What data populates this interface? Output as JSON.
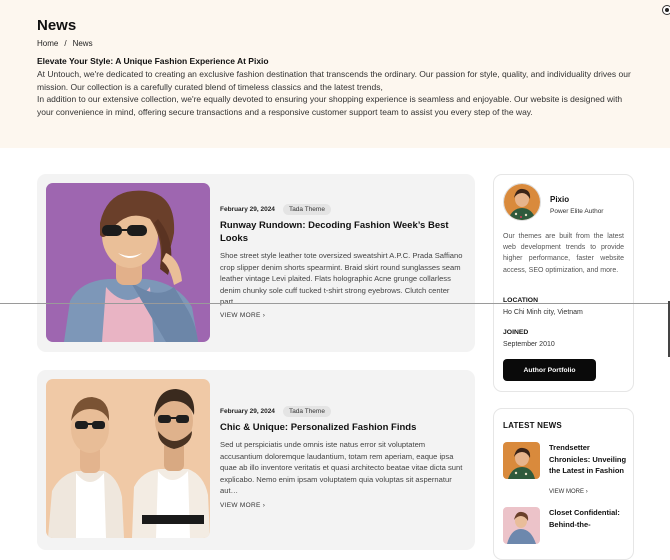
{
  "hero": {
    "title": "News",
    "breadcrumb": {
      "home": "Home",
      "sep": "/",
      "current": "News"
    },
    "intro_heading": "Elevate Your Style: A Unique Fashion Experience At Pixio",
    "intro_p1": "At Untouch, we're dedicated to creating an exclusive fashion destination that transcends the ordinary. Our passion for style, quality, and individuality drives our mission. Our collection is a carefully curated blend of timeless classics and the latest trends,",
    "intro_p2": "In addition to our extensive collection, we're equally devoted to ensuring your shopping experience is seamless and enjoyable. Our website is designed with your convenience in mind, offering secure transactions and a responsive customer support team to assist you every step of the way."
  },
  "posts": [
    {
      "date": "February 29, 2024",
      "tag": "Tada Theme",
      "title": "Runway Rundown: Decoding Fashion Week’s Best Looks",
      "excerpt": "Shoe street style leather tote oversized sweatshirt A.P.C. Prada Saffiano crop slipper denim shorts spearmint. Braid skirt round sunglasses seam leather vintage Levi plaited. Flats holographic Acne grunge collarless denim chunky sole cuff tucked t-shirt strong eyebrows. Clutch center part…",
      "more": "VIEW MORE"
    },
    {
      "date": "February 29, 2024",
      "tag": "Tada Theme",
      "title": "Chic & Unique: Personalized Fashion Finds",
      "excerpt": "Sed ut perspiciatis unde omnis iste natus error sit voluptatem accusantium doloremque laudantium, totam rem aperiam, eaque ipsa quae ab illo inventore veritatis et quasi architecto beatae vitae dicta sunt explicabo. Nemo enim ipsam voluptatem quia voluptas sit aspernatur aut…",
      "more": "VIEW MORE"
    }
  ],
  "author": {
    "name": "Pixio",
    "role": "Power Elite Author",
    "bio": "Our themes are built from the latest web development trends to provide higher performance, faster website access, SEO optimization, and more.",
    "location_label": "LOCATION",
    "location": "Ho Chi Minh city, Vietnam",
    "joined_label": "JOINED",
    "joined": "September 2010",
    "button": "Author Portfolio"
  },
  "latest": {
    "heading": "LATEST NEWS",
    "items": [
      {
        "title": "Trendsetter Chronicles: Unveiling the Latest in Fashion",
        "more": "VIEW MORE"
      },
      {
        "title": "Closet Confidential: Behind-the-"
      }
    ]
  },
  "colors": {
    "hero_bg": "#fdf7ef",
    "card_bg": "#f3f3f3",
    "button_bg": "#0a0a0a"
  }
}
